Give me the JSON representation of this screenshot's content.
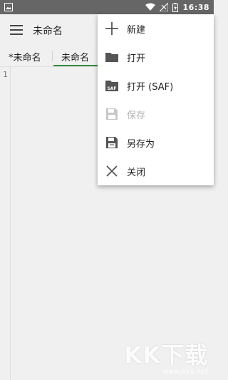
{
  "status_bar": {
    "time": "16:38",
    "icons": [
      "image-icon",
      "wifi-icon",
      "signal-icon",
      "battery-icon"
    ]
  },
  "app_bar": {
    "title": "未命名",
    "menu_icon": "hamburger-icon"
  },
  "tabs": [
    {
      "label": "*未命名",
      "active": false
    },
    {
      "label": "未命名",
      "active": true
    }
  ],
  "editor": {
    "line_numbers": [
      "1"
    ]
  },
  "menu": {
    "items": [
      {
        "label": "新建",
        "icon": "plus-icon",
        "enabled": true
      },
      {
        "label": "打开",
        "icon": "folder-icon",
        "enabled": true
      },
      {
        "label": "打开 (SAF)",
        "icon": "folder-saf-icon",
        "enabled": true
      },
      {
        "label": "保存",
        "icon": "save-icon",
        "enabled": false
      },
      {
        "label": "另存为",
        "icon": "save-as-icon",
        "enabled": true
      },
      {
        "label": "关闭",
        "icon": "close-icon",
        "enabled": true
      }
    ]
  },
  "watermark": {
    "logo": "KK下载",
    "url": "www.kkx.net"
  },
  "colors": {
    "accent": "#2e8b3a",
    "status_bar": "#666666",
    "background": "#f0f0f0",
    "menu_background": "#ffffff",
    "disabled_text": "#b5b5b5"
  }
}
